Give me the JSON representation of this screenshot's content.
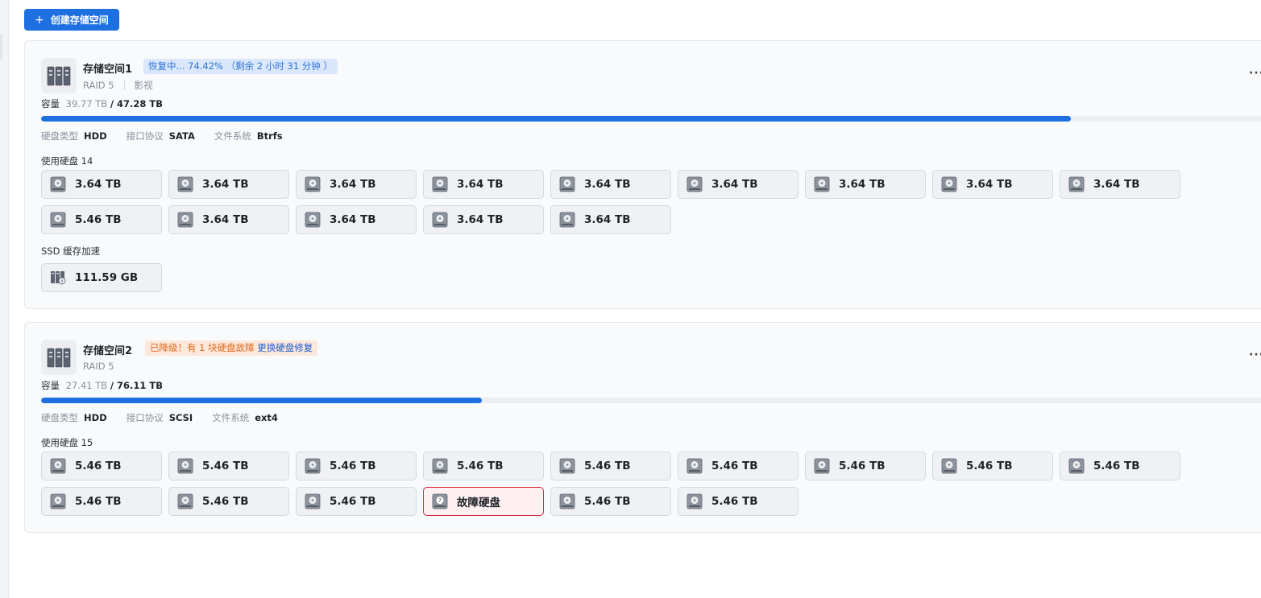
{
  "toolbar": {
    "create_label": "创建存储空间",
    "create_icon": "plus-icon"
  },
  "pools": [
    {
      "name": "存储空间1",
      "status_type": "recovering",
      "status_text": "恢复中... 74.42% （剩余 2 小时 31 分钟 ）",
      "raid": "RAID 5",
      "tag": "影视",
      "capacity_label": "容量",
      "capacity_used": "39.77 TB",
      "capacity_total": "/ 47.28 TB",
      "usage_fraction": 0.841,
      "specs": [
        {
          "key": "硬盘类型",
          "value": "HDD"
        },
        {
          "key": "接口协议",
          "value": "SATA"
        },
        {
          "key": "文件系统",
          "value": "Btrfs"
        }
      ],
      "disks_label": "使用硬盘 14",
      "disks": [
        "3.64 TB",
        "3.64 TB",
        "3.64 TB",
        "3.64 TB",
        "3.64 TB",
        "3.64 TB",
        "3.64 TB",
        "3.64 TB",
        "3.64 TB",
        "5.46 TB",
        "3.64 TB",
        "3.64 TB",
        "3.64 TB",
        "3.64 TB"
      ],
      "ssd_label": "SSD 缓存加速",
      "ssd_disks": [
        "111.59 GB"
      ]
    },
    {
      "name": "存储空间2",
      "status_type": "degraded",
      "status_text": "已降级！有 1 块硬盘故障",
      "status_action": "更换硬盘修复",
      "raid": "RAID 5",
      "capacity_label": "容量",
      "capacity_used": "27.41 TB",
      "capacity_total": "/ 76.11 TB",
      "usage_fraction": 0.36,
      "specs": [
        {
          "key": "硬盘类型",
          "value": "HDD"
        },
        {
          "key": "接口协议",
          "value": "SCSI"
        },
        {
          "key": "文件系统",
          "value": "ext4"
        }
      ],
      "disks_label": "使用硬盘 15",
      "disks": [
        "5.46 TB",
        "5.46 TB",
        "5.46 TB",
        "5.46 TB",
        "5.46 TB",
        "5.46 TB",
        "5.46 TB",
        "5.46 TB",
        "5.46 TB",
        "5.46 TB",
        "5.46 TB",
        "5.46 TB",
        "故障硬盘",
        "5.46 TB",
        "5.46 TB"
      ],
      "fault_label": "故障硬盘"
    }
  ],
  "colors": {
    "accent": "#1e6fe0",
    "warning": "#e06a1c",
    "danger": "#d8283a"
  }
}
